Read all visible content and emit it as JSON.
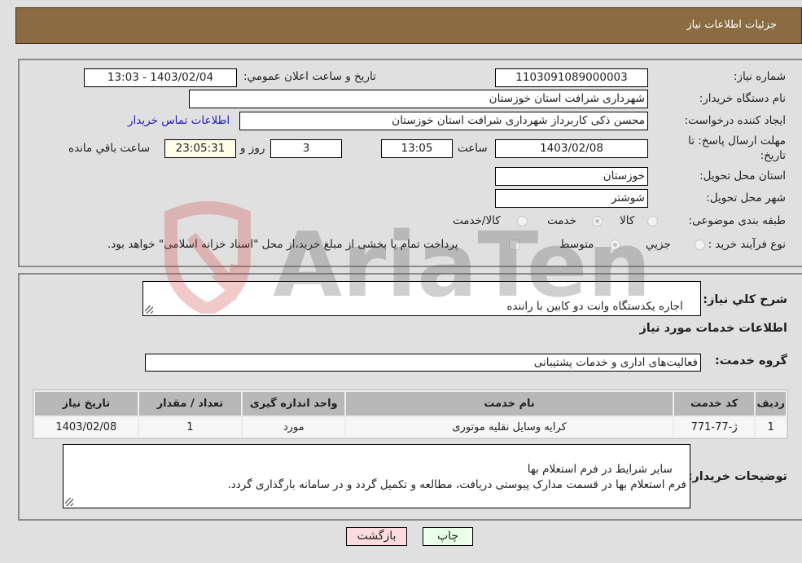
{
  "header": {
    "title": "جزئیات اطلاعات نیاز"
  },
  "fields": {
    "need_number_label": "شماره نیاز:",
    "need_number": "1103091089000003",
    "announce_label": "تاریخ و ساعت اعلان عمومي:",
    "announce_value": "1403/02/04 - 13:03",
    "buyer_org_label": "نام دستگاه خریدار:",
    "buyer_org": "شهرداری شرافت استان خوزستان",
    "creator_label": "ایجاد کننده درخواست:",
    "creator": "محسن ذکی کاربرداز شهرداری شرافت استان خوزستان",
    "contact_link": "اطلاعات تماس خریدار",
    "deadline_label": "مهلت ارسال پاسخ: تا تاریخ:",
    "deadline_date": "1403/02/08",
    "time_label": "ساعت",
    "deadline_time": "13:05",
    "days_value": "3",
    "days_label": "روز و",
    "remaining_time": "23:05:31",
    "remaining_label": "ساعت باقي مانده",
    "province_label": "استان محل تحویل:",
    "province": "خوزستان",
    "city_label": "شهر محل تحویل:",
    "city": "شوشتر",
    "category_label": "طبقه بندی موضوعی:",
    "category_options": [
      "کالا",
      "خدمت",
      "کالا/خدمت"
    ],
    "category_selected": "خدمت",
    "process_label": "نوع فرآیند خرید :",
    "process_options": [
      "جزیي",
      "متوسط"
    ],
    "process_selected": "متوسط",
    "treasury_note": "پرداخت تمام یا بخشی از مبلغ خرید،از محل \"اسناد خزانه اسلامی\" خواهد بود."
  },
  "section2": {
    "summary_label": "شرح کلي نیاز:",
    "summary": "اجاره یکدستگاه وانت دو کابین با راننده",
    "services_heading": "اطلاعات خدمات مورد نیاز",
    "group_label": "گروه خدمت:",
    "group_value": "فعالیت‌های اداری و خدمات پشتیبانی",
    "table": {
      "headers": [
        "ردیف",
        "کد خدمت",
        "نام خدمت",
        "واحد اندازه گیری",
        "تعداد / مقدار",
        "تاریخ نیاز"
      ],
      "rows": [
        [
          "1",
          "ژ-77-771",
          "کرایه وسایل نقلیه موتوری",
          "مورد",
          "1",
          "1403/02/08"
        ]
      ]
    },
    "buyer_notes_label": "توضیحات خریدار:",
    "buyer_notes": "سایر شرایط در فرم استعلام بها\nفرم استعلام بها در قسمت مدارک پیوستی دریافت، مطالعه و تکمیل گردد و در سامانه بارگذاری گردد."
  },
  "buttons": {
    "print": "چاپ",
    "back": "بازگشت"
  },
  "watermark": {
    "text": "AriaTender.neT"
  }
}
